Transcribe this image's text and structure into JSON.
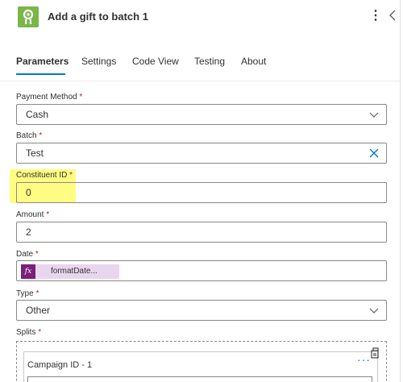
{
  "header": {
    "title": "Add a gift to batch 1",
    "app_icon": "connector-logo-icon",
    "more_label": "⋮",
    "collapse_icon": "chevron-left-icon"
  },
  "tabs": [
    {
      "label": "Parameters",
      "active": true
    },
    {
      "label": "Settings",
      "active": false
    },
    {
      "label": "Code View",
      "active": false
    },
    {
      "label": "Testing",
      "active": false
    },
    {
      "label": "About",
      "active": false
    }
  ],
  "fields": {
    "payment_method": {
      "label": "Payment Method",
      "required": "*",
      "value": "Cash"
    },
    "batch": {
      "label": "Batch",
      "required": "*",
      "value": "Test"
    },
    "constituent_id": {
      "label": "Constituent ID",
      "required": "*",
      "value": "0"
    },
    "amount": {
      "label": "Amount",
      "required": "*",
      "value": "2"
    },
    "date": {
      "label": "Date",
      "required": "*",
      "token_icon": "fx",
      "token_text": "formatDate..."
    },
    "type": {
      "label": "Type",
      "required": "*",
      "value": "Other"
    },
    "splits": {
      "label": "Splits",
      "required": "*",
      "campaign_label": "Campaign ID - 1",
      "more_label": "···"
    }
  },
  "colors": {
    "accent": "#0078d4",
    "required": "#a4262c",
    "highlight": "#fffb6d",
    "token_bg": "#e8d6ee",
    "token_icon_bg": "#7a1f7a",
    "app_icon_bg": "#7ab648"
  }
}
